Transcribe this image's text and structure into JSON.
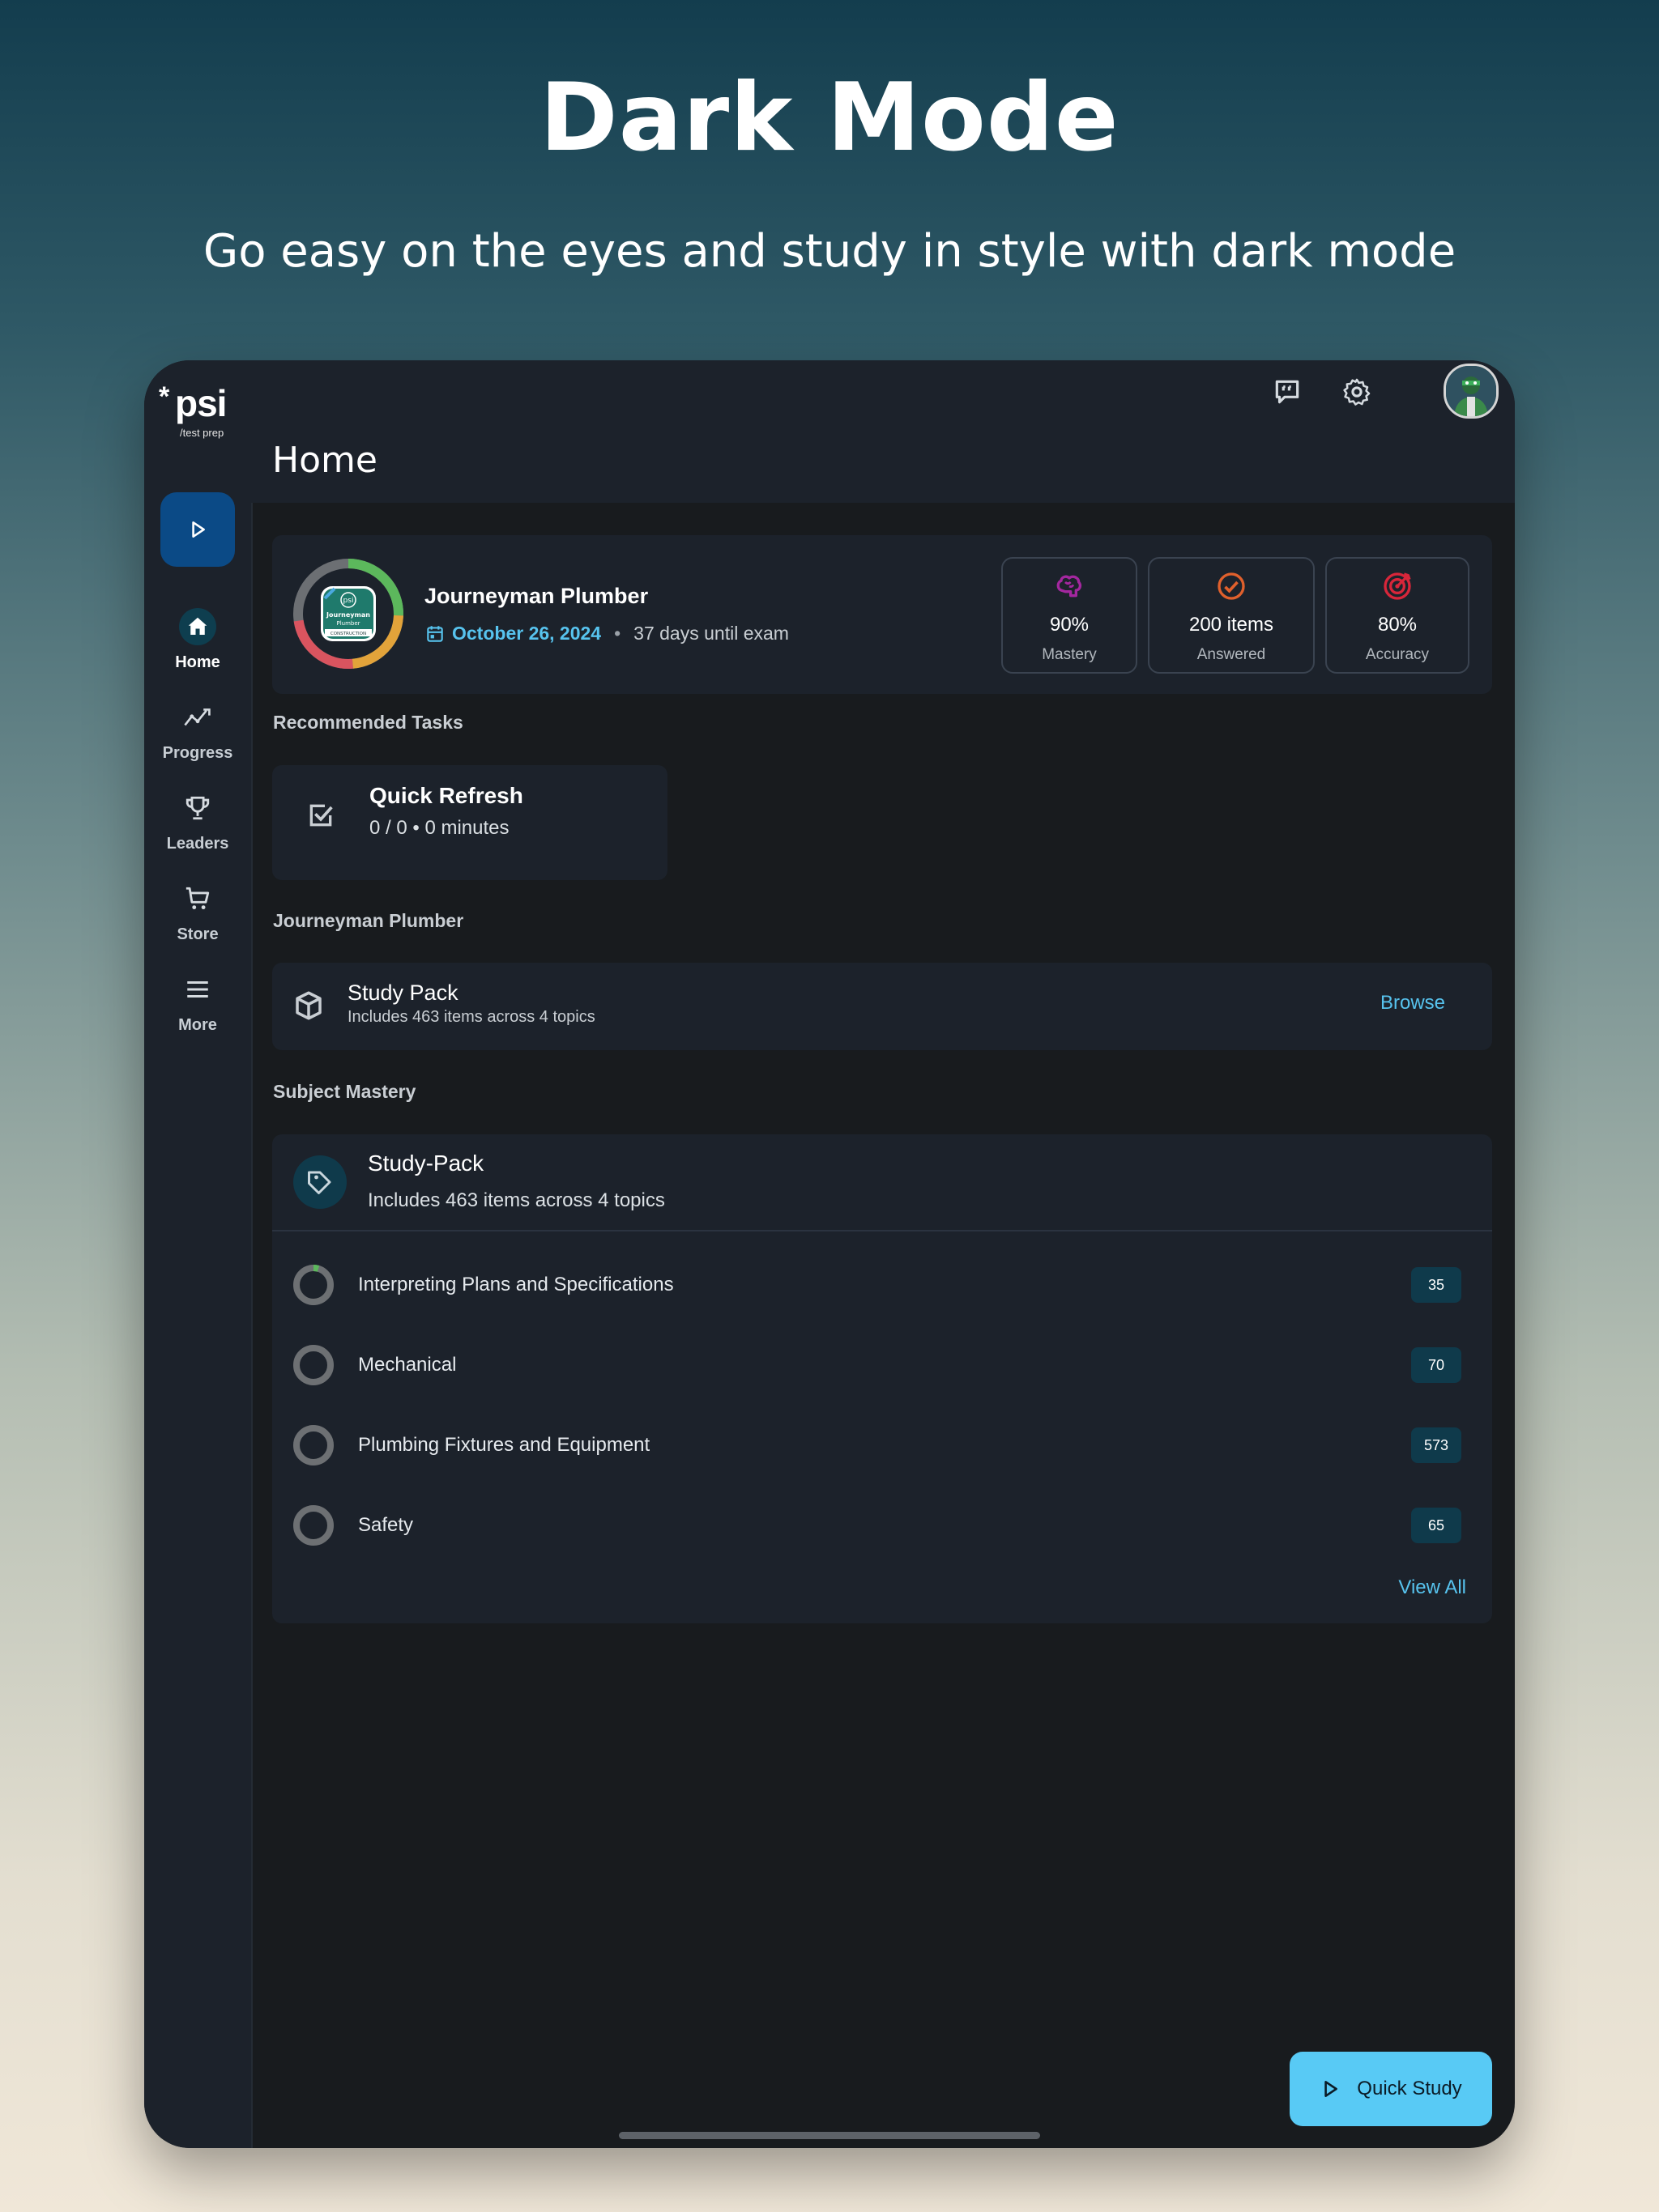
{
  "hero": {
    "title": "Dark Mode",
    "subtitle": "Go easy on the eyes and study in style with dark mode"
  },
  "logo": {
    "brand": "psi",
    "tagline": "/test prep"
  },
  "sidebar": {
    "items": [
      {
        "label": "Home",
        "icon": "home-icon",
        "active": true
      },
      {
        "label": "Progress",
        "icon": "trend-icon"
      },
      {
        "label": "Leaders",
        "icon": "trophy-icon"
      },
      {
        "label": "Store",
        "icon": "cart-icon"
      },
      {
        "label": "More",
        "icon": "menu-icon"
      }
    ]
  },
  "header": {
    "title": "Home"
  },
  "exam": {
    "badge_text": [
      "psi",
      "Journeyman",
      "Plumber",
      "CONSTRUCTION"
    ],
    "name": "Journeyman Plumber",
    "date": "October 26, 2024",
    "days_until": "37 days until exam",
    "stats": [
      {
        "value": "90%",
        "label": "Mastery",
        "icon": "brain-icon",
        "color": "#a4279f"
      },
      {
        "value": "200 items",
        "label": "Answered",
        "icon": "check-circle-icon",
        "color": "#e0602c"
      },
      {
        "value": "80%",
        "label": "Accuracy",
        "icon": "target-icon",
        "color": "#d8263a"
      }
    ],
    "ring_colors": [
      "#5cb85c",
      "#e2a33a",
      "#d9545f",
      "#6c6f73"
    ]
  },
  "recommended": {
    "label": "Recommended Tasks",
    "task": {
      "title": "Quick Refresh",
      "sub": "0 / 0 • 0 minutes"
    }
  },
  "pack_section": {
    "label": "Journeyman Plumber",
    "pack": {
      "title": "Study Pack",
      "sub": "Includes 463 items across 4 topics",
      "action": "Browse"
    }
  },
  "mastery": {
    "label": "Subject Mastery",
    "title": "Study-Pack",
    "sub": "Includes 463 items across 4 topics",
    "topics": [
      {
        "name": "Interpreting Plans and Specifications",
        "count": "35"
      },
      {
        "name": "Mechanical",
        "count": "70"
      },
      {
        "name": "Plumbing Fixtures and Equipment",
        "count": "573"
      },
      {
        "name": "Safety",
        "count": "65"
      }
    ],
    "view_all": "View All"
  },
  "fab": {
    "label": "Quick Study"
  },
  "colors": {
    "accent": "#57c3ee",
    "fab": "#58caf5",
    "surface": "#1c222b",
    "background": "#181b1e"
  }
}
